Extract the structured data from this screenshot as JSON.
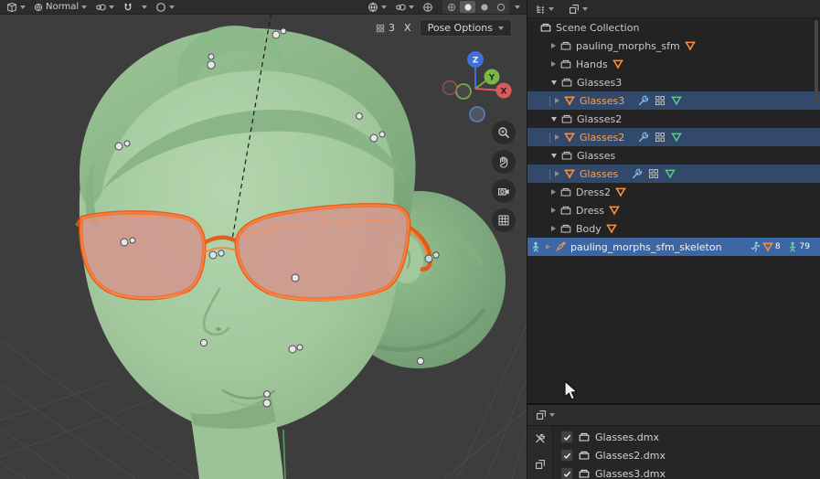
{
  "viewport": {
    "header": {
      "orientation_label": "Normal"
    },
    "overlay": {
      "count_badge": "3",
      "axis_clear": "X",
      "pose_options": "Pose Options"
    },
    "gizmo": {
      "x": "X",
      "y": "Y",
      "z": "Z"
    }
  },
  "outliner": {
    "rows": [
      {
        "label": "Scene Collection",
        "type": "scene-collection"
      },
      {
        "label": "pauling_morphs_sfm",
        "type": "collection-collapsed"
      },
      {
        "label": "Hands",
        "type": "collection-collapsed"
      },
      {
        "label": "Glasses3",
        "type": "collection-expanded"
      },
      {
        "label": "Glasses3",
        "type": "mesh-object",
        "selected": true
      },
      {
        "label": "Glasses2",
        "type": "collection-expanded"
      },
      {
        "label": "Glasses2",
        "type": "mesh-object",
        "selected": true
      },
      {
        "label": "Glasses",
        "type": "collection-expanded"
      },
      {
        "label": "Glasses",
        "type": "mesh-object",
        "selected": true
      },
      {
        "label": "Dress2",
        "type": "collection-collapsed"
      },
      {
        "label": "Dress",
        "type": "collection-collapsed"
      },
      {
        "label": "Body",
        "type": "collection-collapsed"
      },
      {
        "label": "pauling_morphs_sfm_skeleton",
        "type": "armature-object",
        "active": true,
        "mesh_count": "8",
        "bone_count": "79"
      }
    ]
  },
  "file_panel": {
    "items": [
      {
        "label": "Glasses.dmx",
        "checked": true
      },
      {
        "label": "Glasses2.dmx",
        "checked": true
      },
      {
        "label": "Glasses3.dmx",
        "checked": true
      }
    ]
  },
  "colors": {
    "selection_blue": "#33496b",
    "active_blue": "#3c66a4",
    "object_orange": "#ff9140",
    "mesh_green": "#56c983",
    "modifier_blue": "#7fb3e6",
    "glasses_highlight": "#ff6a1a",
    "viewport_bg": "#3d3d3d"
  }
}
